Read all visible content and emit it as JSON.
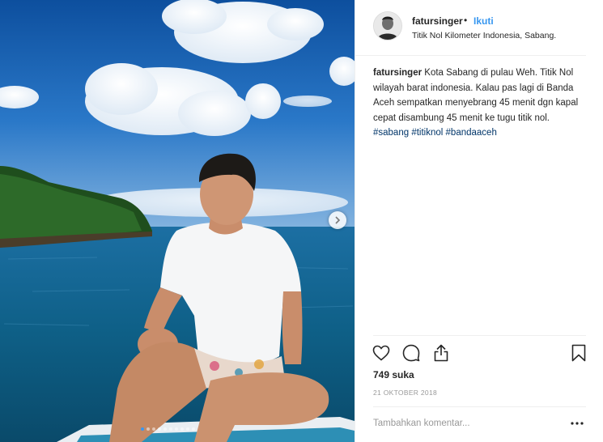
{
  "post": {
    "username": "fatursinger",
    "separator": "•",
    "follow_label": "Ikuti",
    "location": "Titik Nol Kilometer Indonesia, Sabang.",
    "caption": {
      "username": "fatursinger",
      "text": " Kota Sabang di pulau Weh. Titik Nol wilayah barat indonesia. Kalau pas lagi di Banda Aceh sempatkan menyebrang 45 menit dgn kapal cepat disambung 45 menit ke tugu titik nol. ",
      "hashtags": [
        "#sabang",
        "#titiknol",
        "#bandaaceh"
      ]
    },
    "likes": "749 suka",
    "date": "21 OKTOBER 2018",
    "comment_placeholder": "Tambahkan komentar...",
    "carousel": {
      "total": 10,
      "active_index": 0
    },
    "icons": {
      "like": "heart-icon",
      "comment": "comment-icon",
      "share": "share-icon",
      "save": "bookmark-icon",
      "next": "chevron-right-icon",
      "more": "more-options-icon"
    },
    "colors": {
      "accent": "#3897f0",
      "hashtag": "#003569",
      "muted": "#999999",
      "text": "#262626"
    }
  }
}
